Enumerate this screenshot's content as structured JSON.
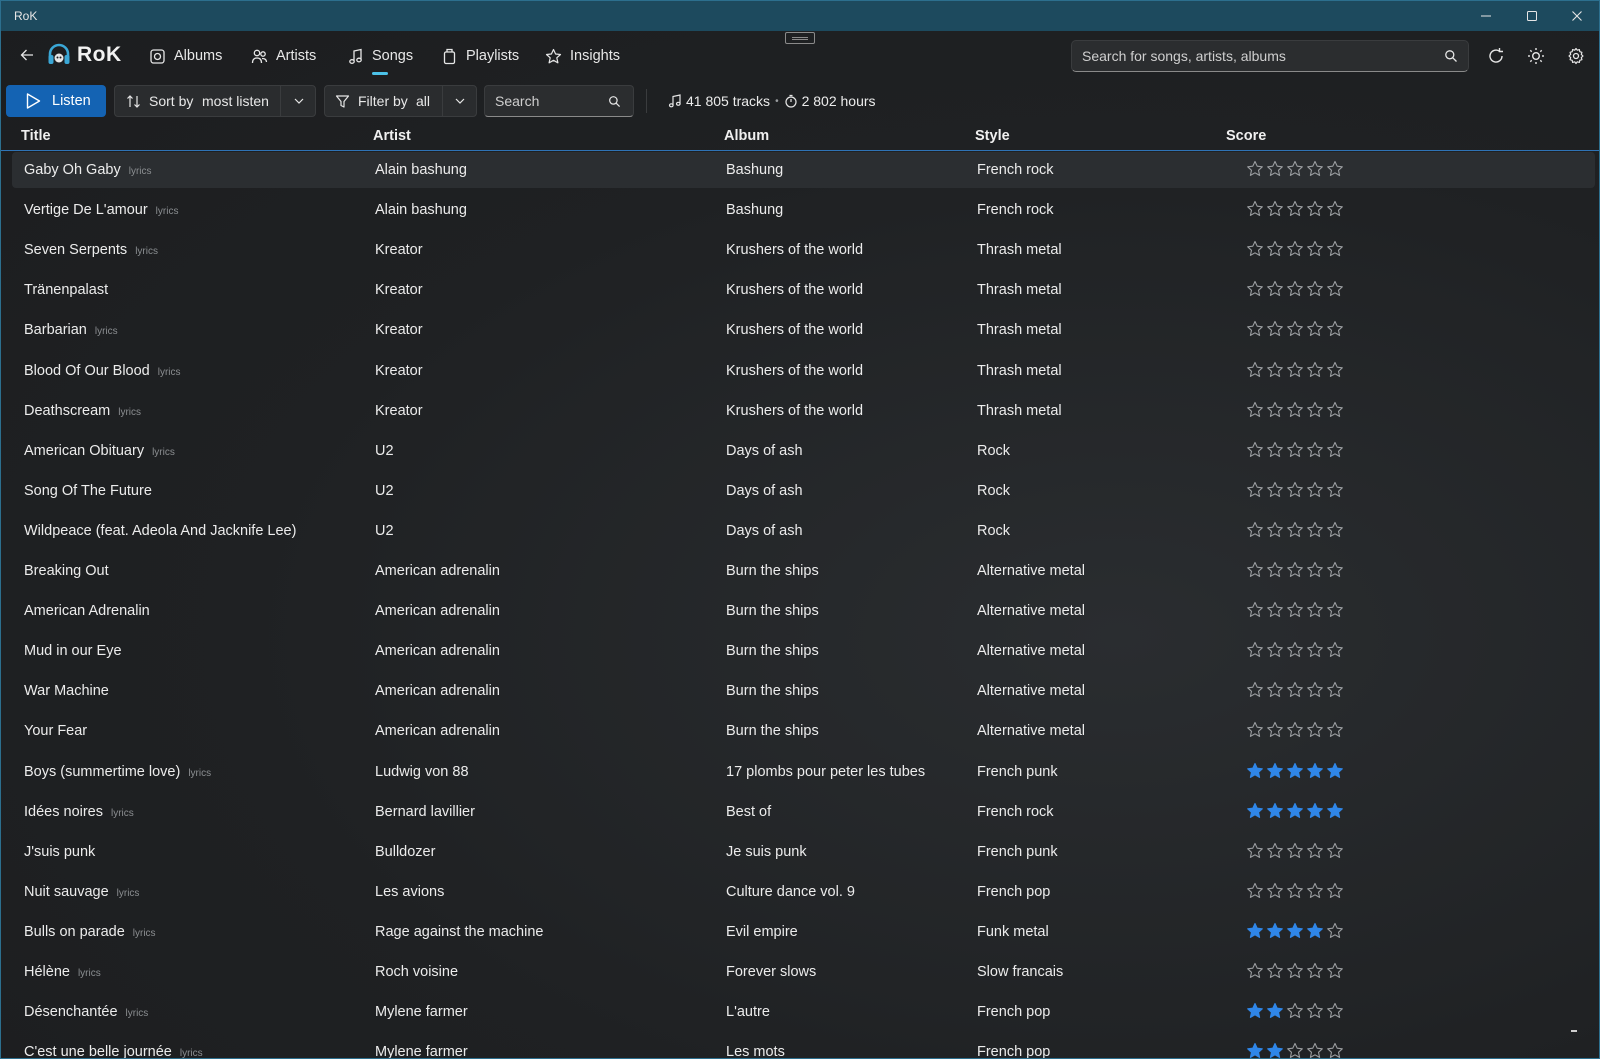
{
  "window": {
    "title": "RoK"
  },
  "app": {
    "name": "RoK"
  },
  "nav": {
    "items": [
      {
        "label": "Albums",
        "icon": "disc-icon"
      },
      {
        "label": "Artists",
        "icon": "people-icon"
      },
      {
        "label": "Songs",
        "icon": "music-note-icon",
        "active": true
      },
      {
        "label": "Playlists",
        "icon": "playlist-icon"
      },
      {
        "label": "Insights",
        "icon": "star-icon"
      }
    ]
  },
  "search": {
    "placeholder": "Search for songs, artists, albums"
  },
  "toolbar": {
    "listen_label": "Listen",
    "sort_label": "Sort by",
    "sort_value": "most listen",
    "filter_label": "Filter by",
    "filter_value": "all",
    "search_placeholder": "Search",
    "tracks": "41 805 tracks",
    "separator": "•",
    "hours": "2 802 hours"
  },
  "table": {
    "columns": [
      "Title",
      "Artist",
      "Album",
      "Style",
      "Score"
    ],
    "lyrics_label": "lyrics",
    "rows": [
      {
        "title": "Gaby Oh Gaby",
        "lyrics": true,
        "artist": "Alain bashung",
        "album": "Bashung",
        "style": "French rock",
        "score": 0
      },
      {
        "title": "Vertige De L'amour",
        "lyrics": true,
        "artist": "Alain bashung",
        "album": "Bashung",
        "style": "French rock",
        "score": 0
      },
      {
        "title": "Seven Serpents",
        "lyrics": true,
        "artist": "Kreator",
        "album": "Krushers of the world",
        "style": "Thrash metal",
        "score": 0
      },
      {
        "title": "Tränenpalast",
        "lyrics": false,
        "artist": "Kreator",
        "album": "Krushers of the world",
        "style": "Thrash metal",
        "score": 0
      },
      {
        "title": "Barbarian",
        "lyrics": true,
        "artist": "Kreator",
        "album": "Krushers of the world",
        "style": "Thrash metal",
        "score": 0
      },
      {
        "title": "Blood Of Our Blood",
        "lyrics": true,
        "artist": "Kreator",
        "album": "Krushers of the world",
        "style": "Thrash metal",
        "score": 0
      },
      {
        "title": "Deathscream",
        "lyrics": true,
        "artist": "Kreator",
        "album": "Krushers of the world",
        "style": "Thrash metal",
        "score": 0
      },
      {
        "title": "American Obituary",
        "lyrics": true,
        "artist": "U2",
        "album": "Days of ash",
        "style": "Rock",
        "score": 0
      },
      {
        "title": "Song Of The Future",
        "lyrics": false,
        "artist": "U2",
        "album": "Days of ash",
        "style": "Rock",
        "score": 0
      },
      {
        "title": "Wildpeace (feat. Adeola And Jacknife Lee)",
        "lyrics": false,
        "artist": "U2",
        "album": "Days of ash",
        "style": "Rock",
        "score": 0
      },
      {
        "title": "Breaking Out",
        "lyrics": false,
        "artist": "American adrenalin",
        "album": "Burn the ships",
        "style": "Alternative metal",
        "score": 0
      },
      {
        "title": "American Adrenalin",
        "lyrics": false,
        "artist": "American adrenalin",
        "album": "Burn the ships",
        "style": "Alternative metal",
        "score": 0
      },
      {
        "title": "Mud in our Eye",
        "lyrics": false,
        "artist": "American adrenalin",
        "album": "Burn the ships",
        "style": "Alternative metal",
        "score": 0
      },
      {
        "title": "War Machine",
        "lyrics": false,
        "artist": "American adrenalin",
        "album": "Burn the ships",
        "style": "Alternative metal",
        "score": 0
      },
      {
        "title": "Your Fear",
        "lyrics": false,
        "artist": "American adrenalin",
        "album": "Burn the ships",
        "style": "Alternative metal",
        "score": 0
      },
      {
        "title": "Boys (summertime love)",
        "lyrics": true,
        "artist": "Ludwig von 88",
        "album": "17 plombs pour peter les tubes",
        "style": "French punk",
        "score": 5
      },
      {
        "title": "Idées noires",
        "lyrics": true,
        "artist": "Bernard lavillier",
        "album": "Best of",
        "style": "French rock",
        "score": 5
      },
      {
        "title": "J'suis punk",
        "lyrics": false,
        "artist": "Bulldozer",
        "album": "Je suis punk",
        "style": "French punk",
        "score": 0
      },
      {
        "title": "Nuit sauvage",
        "lyrics": true,
        "artist": "Les avions",
        "album": "Culture dance vol. 9",
        "style": "French pop",
        "score": 0
      },
      {
        "title": "Bulls on parade",
        "lyrics": true,
        "artist": "Rage against the machine",
        "album": "Evil empire",
        "style": "Funk metal",
        "score": 4
      },
      {
        "title": "Hélène",
        "lyrics": true,
        "artist": "Roch voisine",
        "album": "Forever slows",
        "style": "Slow francais",
        "score": 0
      },
      {
        "title": "Désenchantée",
        "lyrics": true,
        "artist": "Mylene farmer",
        "album": "L'autre",
        "style": "French pop",
        "score": 2
      },
      {
        "title": "C'est une belle journée",
        "lyrics": true,
        "artist": "Mylene farmer",
        "album": "Les mots",
        "style": "French pop",
        "score": 2
      }
    ]
  },
  "colors": {
    "accent": "#4cc2e8",
    "listen_button": "#1463b3",
    "star_filled": "#2f86e8",
    "star_empty": "#9a9da0",
    "titlebar": "#1d4a5e"
  }
}
